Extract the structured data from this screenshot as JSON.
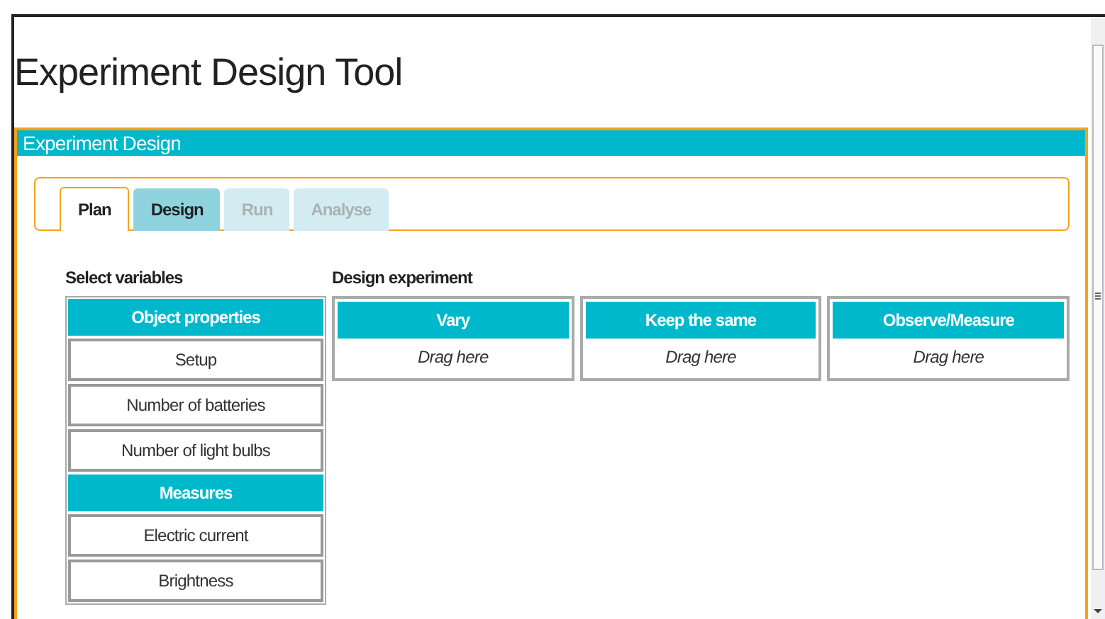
{
  "title": "Experiment Design Tool",
  "panel": {
    "title": "Experiment Design"
  },
  "tabs": [
    {
      "label": "Plan",
      "selected": true,
      "disabled": false
    },
    {
      "label": "Design",
      "selected": false,
      "disabled": false
    },
    {
      "label": "Run",
      "selected": false,
      "disabled": true
    },
    {
      "label": "Analyse",
      "selected": false,
      "disabled": true
    }
  ],
  "variables": {
    "heading": "Select variables",
    "groups": [
      {
        "title": "Object properties",
        "items": [
          "Setup",
          "Number of batteries",
          "Number of light bulbs"
        ]
      },
      {
        "title": "Measures",
        "items": [
          "Electric current",
          "Brightness"
        ]
      }
    ]
  },
  "design": {
    "heading": "Design experiment",
    "columns": [
      {
        "title": "Vary",
        "hint": "Drag here"
      },
      {
        "title": "Keep the same",
        "hint": "Drag here"
      },
      {
        "title": "Observe/Measure",
        "hint": "Drag here"
      }
    ]
  }
}
